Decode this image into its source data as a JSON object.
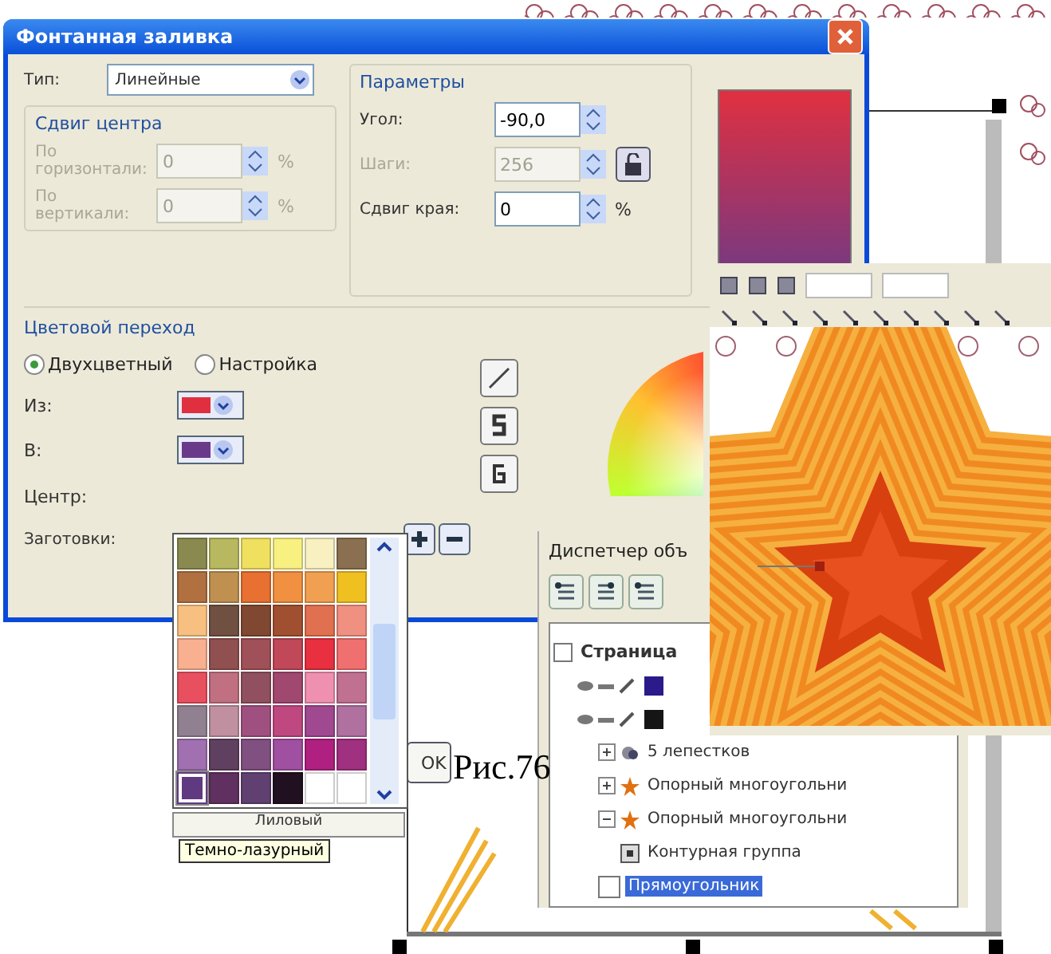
{
  "dialog": {
    "title": "Фонтанная заливка",
    "type_label": "Тип:",
    "type_value": "Линейные",
    "center_offset": {
      "title": "Сдвиг центра",
      "fields": [
        {
          "label": "По горизонтали:",
          "value": "0",
          "unit": "%",
          "disabled": true
        },
        {
          "label": "По вертикали:",
          "value": "0",
          "unit": "%",
          "disabled": true
        }
      ]
    },
    "parameters": {
      "title": "Параметры",
      "fields": [
        {
          "kind": "angle",
          "label": "Угол:",
          "value": "-90,0",
          "disabled": false
        },
        {
          "kind": "steps",
          "label": "Шаги:",
          "value": "256",
          "disabled": true
        },
        {
          "kind": "edge",
          "label": "Сдвиг края:",
          "value": "0",
          "unit": "%",
          "disabled": false
        }
      ]
    },
    "color_blend": {
      "title": "Цветовой переход",
      "modes": [
        {
          "label": "Двухцветный",
          "selected": true
        },
        {
          "label": "Настройка",
          "selected": false
        }
      ],
      "from": {
        "label": "Из:",
        "color": "#e03040"
      },
      "to": {
        "label": "В:",
        "color": "#6a3a8a"
      },
      "center_label": "Центр:"
    },
    "presets_label": "Заготовки:",
    "ok_button": "OK",
    "palette": {
      "color_name": "Лиловый",
      "tooltip": "Темно-лазурный",
      "cells": [
        {
          "color": "#8a8a50",
          "selected": false
        },
        {
          "color": "#b8b860",
          "selected": false
        },
        {
          "color": "#f0e060",
          "selected": false
        },
        {
          "color": "#f8f080",
          "selected": false
        },
        {
          "color": "#f8f0c0",
          "selected": false
        },
        {
          "color": "#8a7050",
          "selected": false
        },
        {
          "color": "#b07040",
          "selected": false
        },
        {
          "color": "#c09050",
          "selected": false
        },
        {
          "color": "#e87030",
          "selected": false
        },
        {
          "color": "#f09040",
          "selected": false
        },
        {
          "color": "#f0a050",
          "selected": false
        },
        {
          "color": "#f0c020",
          "selected": false
        },
        {
          "color": "#f8c080",
          "selected": false
        },
        {
          "color": "#705040",
          "selected": false
        },
        {
          "color": "#804830",
          "selected": false
        },
        {
          "color": "#a05030",
          "selected": false
        },
        {
          "color": "#e07050",
          "selected": false
        },
        {
          "color": "#f09080",
          "selected": false
        },
        {
          "color": "#f8b090",
          "selected": false
        },
        {
          "color": "#905050",
          "selected": false
        },
        {
          "color": "#a05058",
          "selected": false
        },
        {
          "color": "#c04858",
          "selected": false
        },
        {
          "color": "#e83040",
          "selected": false
        },
        {
          "color": "#f07070",
          "selected": false
        },
        {
          "color": "#e85060",
          "selected": false
        },
        {
          "color": "#c07080",
          "selected": false
        },
        {
          "color": "#905060",
          "selected": false
        },
        {
          "color": "#a04870",
          "selected": false
        },
        {
          "color": "#f090b0",
          "selected": false
        },
        {
          "color": "#c07090",
          "selected": false
        },
        {
          "color": "#908090",
          "selected": false
        },
        {
          "color": "#c090a0",
          "selected": false
        },
        {
          "color": "#a05080",
          "selected": false
        },
        {
          "color": "#c04880",
          "selected": false
        },
        {
          "color": "#a04890",
          "selected": false
        },
        {
          "color": "#b070a0",
          "selected": false
        },
        {
          "color": "#a070b0",
          "selected": false
        },
        {
          "color": "#604060",
          "selected": false
        },
        {
          "color": "#805080",
          "selected": false
        },
        {
          "color": "#a050a0",
          "selected": false
        },
        {
          "color": "#b02080",
          "selected": false
        },
        {
          "color": "#a03080",
          "selected": false
        },
        {
          "color": "#603a80",
          "selected": true
        },
        {
          "color": "#603060",
          "selected": false
        },
        {
          "color": "#604070",
          "selected": false
        },
        {
          "color": "#201020",
          "selected": false
        },
        {
          "color": "#ffffff",
          "selected": false
        },
        {
          "color": "#ffffff",
          "selected": false
        }
      ]
    }
  },
  "object_manager": {
    "title": "Диспетчер объ",
    "tree": [
      {
        "label": "Страница",
        "selected": false,
        "children": [
          {
            "kind": "layer",
            "color": "#2a1a8a"
          },
          {
            "kind": "layer",
            "color": "#151515",
            "children": [
              {
                "kind": "group",
                "label": "5 лепестков",
                "expanded": false,
                "selected": false
              },
              {
                "kind": "star",
                "label": "Опорный многоугольни",
                "expanded": false,
                "selected": false
              },
              {
                "kind": "star",
                "label": "Опорный многоугольни",
                "expanded": true,
                "selected": false,
                "children": [
                  {
                    "kind": "contour",
                    "label": "Контурная группа",
                    "selected": false
                  }
                ]
              },
              {
                "kind": "rect",
                "label": "Прямоугольник",
                "selected": true
              }
            ]
          }
        ]
      }
    ]
  },
  "caption": "Рис.76"
}
